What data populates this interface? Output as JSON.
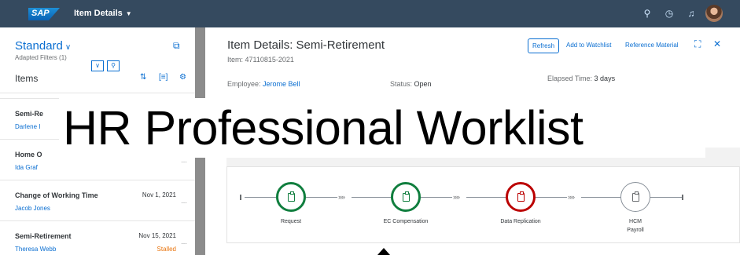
{
  "shell": {
    "logo": "SAP",
    "title": "Item Details",
    "icons": [
      "search-icon",
      "history-icon",
      "bell-icon",
      "user-avatar"
    ]
  },
  "master": {
    "variant": "Standard",
    "adapted_filters": "Adapted Filters (1)",
    "items_title": "Items",
    "rows": [
      {
        "title": "Semi-Re",
        "person": "Darlene I",
        "date": "",
        "status": ""
      },
      {
        "title": "Home O",
        "person": "Ida Graf",
        "date": "",
        "status": ""
      },
      {
        "title": "Change of Working Time",
        "person": "Jacob Jones",
        "date": "Nov 1, 2021",
        "status": ""
      },
      {
        "title": "Semi-Retirement",
        "person": "Theresa Webb",
        "date": "Nov 15, 2021",
        "status": "Stalled"
      }
    ]
  },
  "detail": {
    "title": "Item Details: Semi-Retirement",
    "item_id": "Item: 47110815-2021",
    "refresh": "Refresh",
    "add_watchlist": "Add to Watchlist",
    "reference_material": "Reference Material",
    "employee_label": "Employee:",
    "employee_name": "Jerome Bell",
    "status_label": "Status:",
    "status_value": "Open",
    "elapsed_label": "Elapsed Time:",
    "elapsed_value": "3 days"
  },
  "process": {
    "steps": [
      {
        "label": "Request",
        "label2": "",
        "state": "success",
        "color": "#107e3e"
      },
      {
        "label": "EC Compensation",
        "label2": "",
        "state": "success",
        "color": "#107e3e"
      },
      {
        "label": "Data Replication",
        "label2": "",
        "state": "error",
        "color": "#bb0000"
      },
      {
        "label": "HCM",
        "label2": "Payroll",
        "state": "planned",
        "color": "#89919a"
      }
    ]
  },
  "overlay": {
    "text": "HR Professional Worklist"
  }
}
